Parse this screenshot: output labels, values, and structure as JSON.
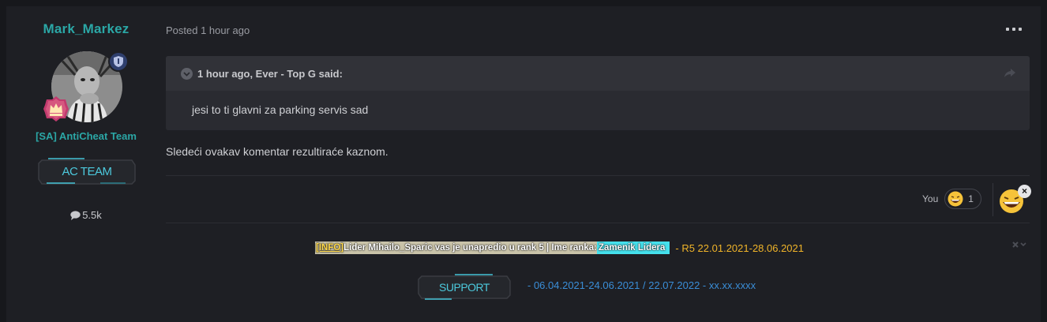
{
  "author": {
    "username": "Mark_Markez",
    "group": "[SA] AntiCheat Team",
    "team_banner": "AC TEAM",
    "post_count": "5.5k"
  },
  "post": {
    "posted": "Posted 1 hour ago",
    "quote": {
      "cite": "1 hour ago, Ever - Top G said:",
      "body": "jesi to ti glavni za parking servis sad"
    },
    "text": "Sledeći ovakav komentar rezultiraće kaznom.",
    "reactions": {
      "you_label": "You",
      "count": "1",
      "close": "×"
    }
  },
  "signature": {
    "info_tag": "[INFO]",
    "info_text": " Lider Mihailo_Sparic vas je unapredio u rank 5 | Ime ranka: ",
    "rank_name": "Zamenik Lidera",
    "rank_line": "- R5 22.01.2021-28.06.2021",
    "support_banner": "SUPPORT",
    "support_line": "- 06.04.2021-24.06.2021 / 22.07.2022 - xx.xx.xxxx"
  },
  "colors": {
    "accent_teal": "#2ba7a6",
    "link_blue": "#3a8ed8",
    "rank_orange": "#f0b429"
  }
}
